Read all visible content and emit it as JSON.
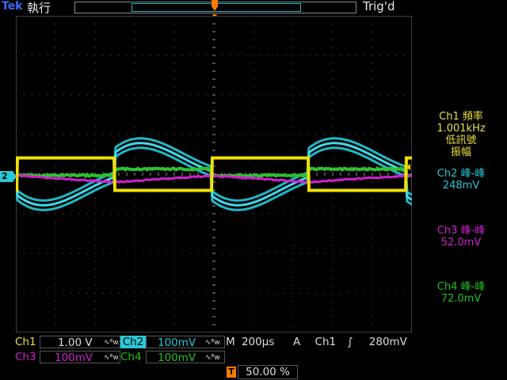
{
  "header": {
    "brand": "Tek",
    "run_state": "執行",
    "trigger_status": "Trig'd",
    "trigger_marker": "T"
  },
  "channels": {
    "ch1": {
      "name": "Ch1",
      "scale": "1.00 V",
      "coupling_icon": "ac-bw-icon",
      "color": "#e8e040"
    },
    "ch2": {
      "name": "Ch2",
      "scale": "100mV",
      "coupling_icon": "ac-bw-icon",
      "color": "#28c8d8",
      "ground_marker": "2"
    },
    "ch3": {
      "name": "Ch3",
      "scale": "100mV",
      "coupling_icon": "ac-bw-icon",
      "color": "#d020d0"
    },
    "ch4": {
      "name": "Ch4",
      "scale": "100mV",
      "coupling_icon": "ac-bw-icon",
      "color": "#20c020"
    }
  },
  "bw_glyph": "∿ᴮw",
  "horizontal": {
    "timebase_label": "M",
    "timebase": "200µs"
  },
  "trigger": {
    "mode_label": "A",
    "source": "Ch1",
    "slope_glyph": "∫",
    "level": "280mV",
    "position_marker": "T",
    "position": "50.00 %"
  },
  "measurements": [
    {
      "line1": "Ch1 頻率",
      "line2": "1.001kHz",
      "line3": "低訊號",
      "line4": "振幅"
    },
    {
      "line1": "Ch2 峰-峰",
      "line2": "248mV"
    },
    {
      "line1": "Ch3 峰-峰",
      "line2": "52.0mV"
    },
    {
      "line1": "Ch4 峰-峰",
      "line2": "72.0mV"
    }
  ],
  "waveforms": {
    "ch1": {
      "type": "square",
      "high_div": 0.25,
      "low_div": -0.25,
      "period_div": 4.9,
      "rising_edges_div": [
        0.0,
        4.9
      ]
    },
    "ch2": {
      "type": "exponential-decay-square",
      "peak_div": 1.2,
      "period_div": 4.9
    },
    "ch3": {
      "type": "sawtooth-flat",
      "level_div": -0.08
    },
    "ch4": {
      "type": "flat-with-steps",
      "level_div": 0.05
    }
  }
}
